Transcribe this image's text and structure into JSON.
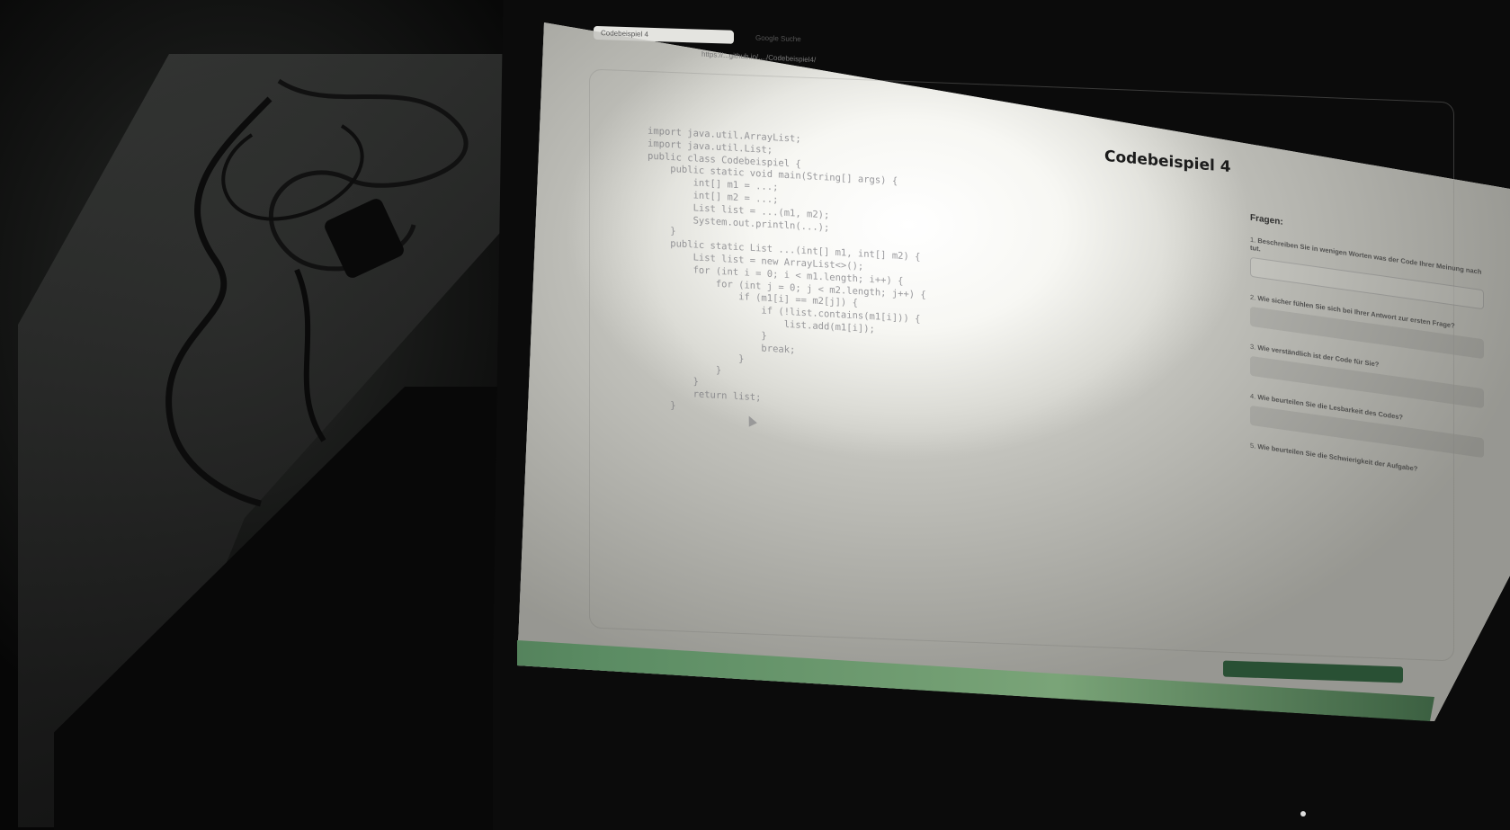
{
  "browser": {
    "tabs": [
      {
        "label": "Codebeispiel 4"
      },
      {
        "label": "Google Suche"
      }
    ],
    "url": "https://...github.io/..../Codebeispiel4/"
  },
  "page": {
    "title": "Codebeispiel 4",
    "code_lines": [
      "import java.util.ArrayList;",
      "import java.util.List;",
      "public class Codebeispiel {",
      "    public static void main(String[] args) {",
      "        int[] m1 = ...;",
      "        int[] m2 = ...;",
      "        List list = ...(m1, m2);",
      "        System.out.println(...);",
      "    }",
      "    public static List ...(int[] m1, int[] m2) {",
      "        List list = new ArrayList<>();",
      "        for (int i = 0; i < m1.length; i++) {",
      "            for (int j = 0; j < m2.length; j++) {",
      "                if (m1[i] == m2[j]) {",
      "                    if (!list.contains(m1[i])) {",
      "                        list.add(m1[i]);",
      "                    }",
      "                    break;",
      "                }",
      "            }",
      "        }",
      "        return list;",
      "    }"
    ]
  },
  "sidebar": {
    "heading": "Fragen:",
    "questions": [
      {
        "number": "1.",
        "text": "Beschreiben Sie in wenigen Worten was der Code Ihrer Meinung nach tut."
      },
      {
        "number": "2.",
        "text": "Wie sicher fühlen Sie sich bei Ihrer Antwort zur ersten Frage?"
      },
      {
        "number": "3.",
        "text": "Wie verständlich ist der Code für Sie?"
      },
      {
        "number": "4.",
        "text": "Wie beurteilen Sie die Lesbarkeit des Codes?"
      },
      {
        "number": "5.",
        "text": "Wie beurteilen Sie die Schwierigkeit der Aufgabe?"
      }
    ]
  },
  "colors": {
    "screen_highlight": "#ffffff",
    "code_text": "#78787d",
    "title_text": "#1b1b1b",
    "submit_button": "#1f5a32",
    "wallpaper_green": "#5b8c63"
  }
}
